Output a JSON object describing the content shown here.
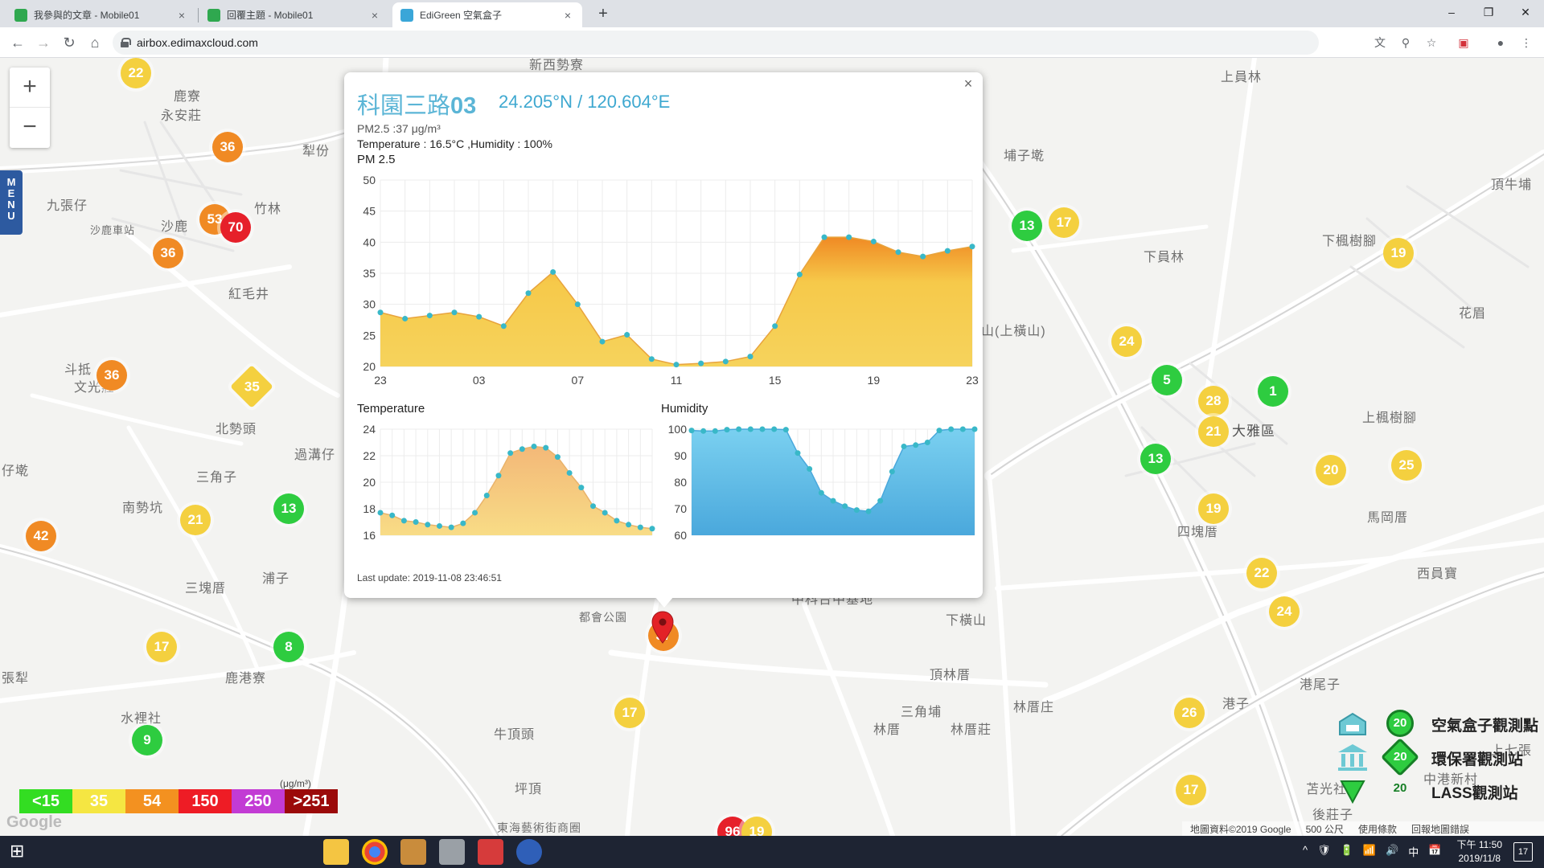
{
  "browser": {
    "tabs": [
      {
        "title": "我參與的文章 - Mobile01",
        "close": "×"
      },
      {
        "title": "回覆主題 - Mobile01",
        "close": "×"
      },
      {
        "title": "EdiGreen 空氣盒子",
        "close": "×"
      }
    ],
    "new_tab": "+",
    "window_controls": {
      "minimize": "–",
      "restore": "❐",
      "close": "✕"
    },
    "nav": {
      "back": "←",
      "forward": "→",
      "reload": "↻",
      "home": "⌂"
    },
    "url": "airbox.edimaxcloud.com",
    "toolbar_icons": [
      "translate-icon",
      "zoom-icon",
      "star-icon",
      "extension-icon",
      "profile-icon",
      "menu-icon"
    ]
  },
  "map": {
    "zoom_in": "+",
    "zoom_out": "−",
    "menu": "MENU",
    "places": [
      {
        "text": "新西勢寮"
      },
      {
        "text": "鹿寮"
      },
      {
        "text": "永安莊"
      },
      {
        "text": "犁份"
      },
      {
        "text": "竹林"
      },
      {
        "text": "九張仔"
      },
      {
        "text": "沙鹿"
      },
      {
        "text": "沙鹿車站"
      },
      {
        "text": "紅毛井"
      },
      {
        "text": "斗抵"
      },
      {
        "text": "文光莊"
      },
      {
        "text": "北勢頭"
      },
      {
        "text": "過溝仔"
      },
      {
        "text": "三角子"
      },
      {
        "text": "南勢坑"
      },
      {
        "text": "仔墘"
      },
      {
        "text": "三塊厝"
      },
      {
        "text": "浦子"
      },
      {
        "text": "鹿港寮"
      },
      {
        "text": "水裡社"
      },
      {
        "text": "張犁"
      },
      {
        "text": "牛頂頭"
      },
      {
        "text": "坪頂"
      },
      {
        "text": "都會公園"
      },
      {
        "text": "東海藝術街商圈"
      },
      {
        "text": "上員林"
      },
      {
        "text": "埔子墘"
      },
      {
        "text": "頂牛埔"
      },
      {
        "text": "下員林"
      },
      {
        "text": "下楓樹腳"
      },
      {
        "text": "山(上橫山)"
      },
      {
        "text": "花眉"
      },
      {
        "text": "大雅區"
      },
      {
        "text": "上楓樹腳"
      },
      {
        "text": "四塊厝"
      },
      {
        "text": "馬岡厝"
      },
      {
        "text": "西員寶"
      },
      {
        "text": "下橫山"
      },
      {
        "text": "頂林厝"
      },
      {
        "text": "林厝庄"
      },
      {
        "text": "三角埔"
      },
      {
        "text": "林厝"
      },
      {
        "text": "林厝莊"
      },
      {
        "text": "港尾子"
      },
      {
        "text": "港子"
      },
      {
        "text": "上七張"
      },
      {
        "text": "中港新村"
      },
      {
        "text": "苫光社"
      },
      {
        "text": "後莊子"
      },
      {
        "text": "中科台中基地"
      }
    ],
    "markers": [
      {
        "value": "22",
        "level": "yellow"
      },
      {
        "value": "36",
        "level": "orange"
      },
      {
        "value": "53",
        "level": "orange"
      },
      {
        "value": "70",
        "level": "red"
      },
      {
        "value": "36",
        "level": "orange"
      },
      {
        "value": "36",
        "level": "orange"
      },
      {
        "value": "35",
        "level": "yellow"
      },
      {
        "value": "21",
        "level": "yellow"
      },
      {
        "value": "13",
        "level": "green"
      },
      {
        "value": "42",
        "level": "orange"
      },
      {
        "value": "17",
        "level": "yellow"
      },
      {
        "value": "8",
        "level": "green"
      },
      {
        "value": "9",
        "level": "green"
      },
      {
        "value": "17",
        "level": "yellow"
      },
      {
        "value": "37",
        "level": "orange"
      },
      {
        "value": "13",
        "level": "green"
      },
      {
        "value": "17",
        "level": "yellow"
      },
      {
        "value": "19",
        "level": "yellow"
      },
      {
        "value": "24",
        "level": "yellow"
      },
      {
        "value": "5",
        "level": "green"
      },
      {
        "value": "28",
        "level": "yellow"
      },
      {
        "value": "1",
        "level": "green"
      },
      {
        "value": "21",
        "level": "yellow"
      },
      {
        "value": "13",
        "level": "green"
      },
      {
        "value": "20",
        "level": "yellow"
      },
      {
        "value": "25",
        "level": "yellow"
      },
      {
        "value": "19",
        "level": "yellow"
      },
      {
        "value": "22",
        "level": "yellow"
      },
      {
        "value": "24",
        "level": "yellow"
      },
      {
        "value": "26",
        "level": "yellow"
      },
      {
        "value": "17",
        "level": "yellow"
      },
      {
        "value": "96",
        "level": "red"
      },
      {
        "value": "19",
        "level": "yellow"
      }
    ],
    "aqi_legend": [
      {
        "label": "<15",
        "color": "#33dd22"
      },
      {
        "label": "35",
        "color": "#f5e642"
      },
      {
        "label": "54",
        "color": "#f39120"
      },
      {
        "label": "150",
        "color": "#ee1c25"
      },
      {
        "label": "250",
        "color": "#c23bd4"
      },
      {
        "label": ">251",
        "color": "#9b0a0a"
      }
    ],
    "legend_unit": "(μg/m³)",
    "google_logo": "Google",
    "station_types": [
      {
        "icon": "airbox-icon",
        "value": "20",
        "label": "空氣盒子觀測點"
      },
      {
        "icon": "epa-building-icon",
        "value": "20",
        "label": "環保署觀測站"
      },
      {
        "icon": "lass-icon",
        "value": "20",
        "label": "LASS觀測站"
      }
    ],
    "footer": {
      "map_data": "地圖資料©2019 Google",
      "scale": "500 公尺",
      "terms": "使用條款",
      "report": "回報地圖錯誤"
    }
  },
  "popup": {
    "close": "×",
    "station_name_prefix": "科園三路",
    "station_name_number": "03",
    "coords": "24.205°N / 120.604°E",
    "pm_line": "PM2.5 :37 μg/m³",
    "temp_hum_line": "Temperature : 16.5°C ,Humidity : 100%",
    "pm_title": "PM 2.5",
    "temp_title": "Temperature",
    "hum_title": "Humidity",
    "last_update": "Last update: 2019-11-08 23:46:51"
  },
  "chart_data": [
    {
      "type": "area",
      "title": "PM 2.5",
      "x_ticks": [
        "23",
        "03",
        "07",
        "11",
        "15",
        "19",
        "23"
      ],
      "y_ticks": [
        20,
        25,
        30,
        35,
        40,
        45,
        50
      ],
      "ylim": [
        20,
        50
      ],
      "grid": true,
      "fill_colors": {
        "low": "#f6d35c",
        "high": "#f08a24"
      },
      "point_color": "#39b8c8",
      "values": [
        28.7,
        27.7,
        28.2,
        28.7,
        28.0,
        26.5,
        31.8,
        35.2,
        30.0,
        24.0,
        25.1,
        21.2,
        20.3,
        20.5,
        20.8,
        21.6,
        26.5,
        34.8,
        40.8,
        40.8,
        40.1,
        38.4,
        37.7,
        38.6,
        39.3
      ]
    },
    {
      "type": "area",
      "title": "Temperature",
      "y_ticks": [
        16,
        18,
        20,
        22,
        24
      ],
      "ylim": [
        16,
        24
      ],
      "grid": true,
      "fill_color": "#f6c98a",
      "point_color": "#39b8c8",
      "values": [
        17.7,
        17.5,
        17.1,
        17.0,
        16.8,
        16.7,
        16.6,
        16.9,
        17.7,
        19.0,
        20.5,
        22.2,
        22.5,
        22.7,
        22.6,
        21.9,
        20.7,
        19.6,
        18.2,
        17.7,
        17.1,
        16.8,
        16.6,
        16.5
      ]
    },
    {
      "type": "area",
      "title": "Humidity",
      "y_ticks": [
        60,
        70,
        80,
        90,
        100
      ],
      "ylim": [
        60,
        100
      ],
      "grid": true,
      "fill_color": "#6cc5e8",
      "point_color": "#39b8c8",
      "values": [
        99.5,
        99.3,
        99.3,
        99.8,
        100.0,
        100.0,
        100.0,
        100.0,
        99.8,
        91.0,
        85.0,
        76.0,
        73.0,
        71.0,
        69.5,
        69.0,
        73.0,
        84.0,
        93.5,
        94.0,
        95.0,
        99.5,
        100.0,
        100.0,
        100.0
      ]
    }
  ],
  "taskbar": {
    "start": "⊞",
    "apps": [
      "file-explorer-icon",
      "chrome-icon",
      "app-icon",
      "app-icon",
      "app-icon",
      "app-icon"
    ],
    "tray": [
      "^",
      "🛡",
      "🔋",
      "📶",
      "🔊",
      "中",
      "📅"
    ],
    "time": "下午 11:50",
    "date": "2019/11/8",
    "notify": "17"
  }
}
